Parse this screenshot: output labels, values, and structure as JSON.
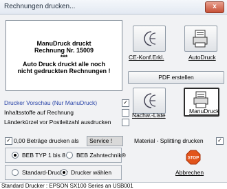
{
  "window": {
    "title": "Rechnungen drucken...",
    "close_label": "x"
  },
  "message": {
    "line1": "ManuDruck druckt",
    "line2": "Rechnung Nr. 15009",
    "line3": "***",
    "line4": "Auto Druck druckt alle noch",
    "line5": "nicht gedruckten Rechnungen !"
  },
  "options": {
    "preview_label": "Drucker Vorschau (Nur ManuDruck)",
    "preview_checked": true,
    "ingredients_label": "Inhaltsstoffe auf Rechnung",
    "ingredients_checked": false,
    "country_label": "Länderkürzel vor Postleitzahl ausdrucken",
    "country_checked": false
  },
  "zero_amounts": {
    "label": "0,00 Beträge drucken als",
    "checked": true,
    "value": "Service !"
  },
  "beb": {
    "option1": "BEB TYP 1 bis 8",
    "option2": "BEB Zahntechnik®",
    "selected": "option1"
  },
  "printer_select": {
    "option1": "Standard-Drucker",
    "option2": "Drucker wählen",
    "selected": "option2"
  },
  "buttons": {
    "ce": "CE-Konf.Erkl.",
    "auto": "AutoDruck",
    "pdf": "PDF erstellen",
    "followup": "Nachw.-Liste",
    "manu": "ManuDruck",
    "cancel": "Abbrechen",
    "stop": "STOP"
  },
  "material": {
    "label": "Material - Splitting drucken",
    "checked": true
  },
  "statusbar": {
    "text": "Standard Drucker :  EPSON SX100 Series an USB001"
  },
  "colors": {
    "link_blue": "#2a45a8",
    "stop_red": "#e2541b"
  }
}
